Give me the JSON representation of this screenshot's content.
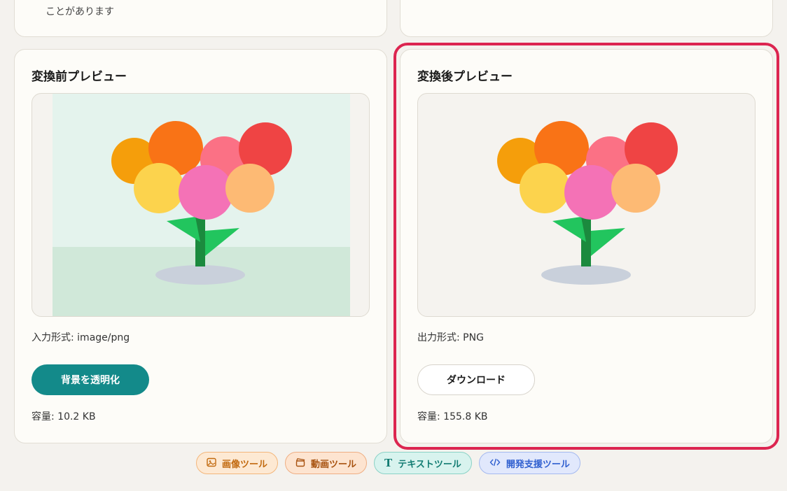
{
  "top_left_card": {
    "note": "ことがあります"
  },
  "before": {
    "title": "変換前プレビュー",
    "format_label": "入力形式: image/png",
    "action_button": "背景を透明化",
    "size_label": "容量: 10.2 KB"
  },
  "after": {
    "title": "変換後プレビュー",
    "format_label": "出力形式: PNG",
    "download_button": "ダウンロード",
    "size_label": "容量: 155.8 KB"
  },
  "nav_chips": [
    {
      "label": "画像ツール",
      "icon": "image-icon",
      "color": "#c26a0f",
      "bg": "#fde9d3",
      "border": "#f3b67a"
    },
    {
      "label": "動画ツール",
      "icon": "clapperboard-icon",
      "color": "#a8520f",
      "bg": "#fde4d0",
      "border": "#efae83"
    },
    {
      "label": "テキストツール",
      "icon": "text-icon",
      "color": "#127c72",
      "bg": "#d8f3ee",
      "border": "#8ad2c6"
    },
    {
      "label": "開発支援ツール",
      "icon": "code-icon",
      "color": "#2f5fcf",
      "bg": "#e1e8fc",
      "border": "#a4b9ef"
    }
  ],
  "colors": {
    "accent_teal": "#138a8a",
    "highlight_red": "#dc2550"
  }
}
